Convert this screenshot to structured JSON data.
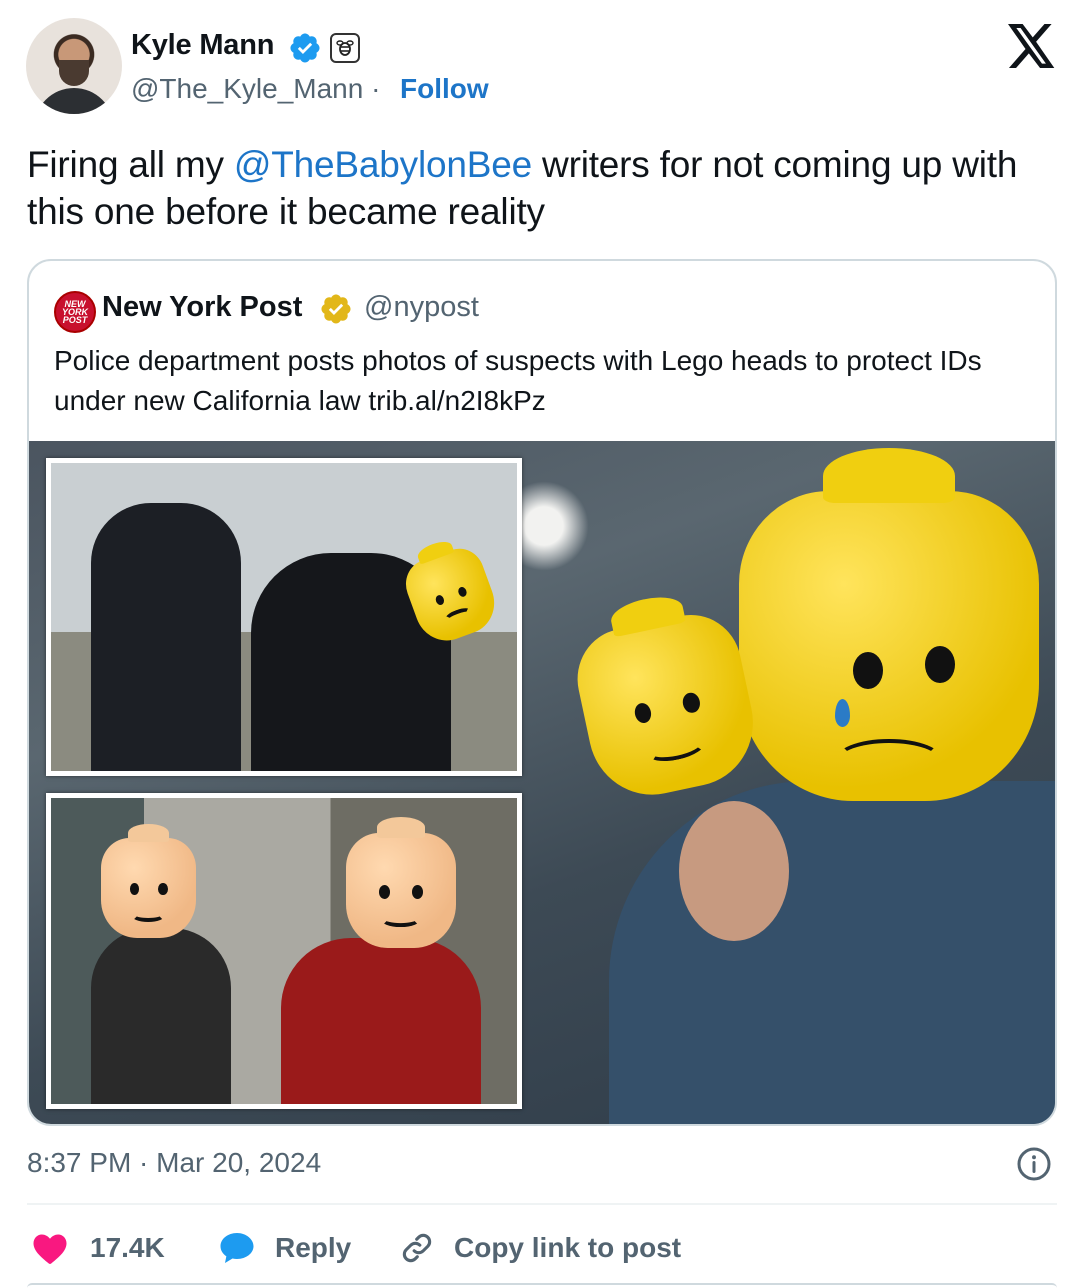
{
  "author": {
    "name": "Kyle Mann",
    "handle": "@The_Kyle_Mann",
    "separator": "·",
    "follow_label": "Follow"
  },
  "tweet": {
    "text_before": "Firing all my ",
    "mention": "@TheBabylonBee",
    "text_after": " writers for not coming up with this one before it became reality"
  },
  "quoted": {
    "logo_text": "NEW YORK POST",
    "name": "New York Post",
    "handle": "@nypost",
    "text": "Police department posts photos of suspects with Lego heads to protect IDs under new California law trib.al/n2I8kPz"
  },
  "footer": {
    "timestamp": "8:37 PM · Mar 20, 2024",
    "likes": "17.4K",
    "reply_label": "Reply",
    "copy_label": "Copy link to post"
  },
  "icons": {
    "verified": "verified-badge-icon",
    "affiliate": "babylon-bee-affiliate-icon",
    "x_logo": "x-logo-icon",
    "heart": "heart-icon",
    "reply": "reply-bubble-icon",
    "link": "link-icon",
    "info": "info-icon"
  },
  "colors": {
    "link_blue": "#1d75c8",
    "verified_blue": "#1d9bf0",
    "gold_check": "#e2b719",
    "heart_red": "#f91880",
    "muted": "#536471"
  }
}
